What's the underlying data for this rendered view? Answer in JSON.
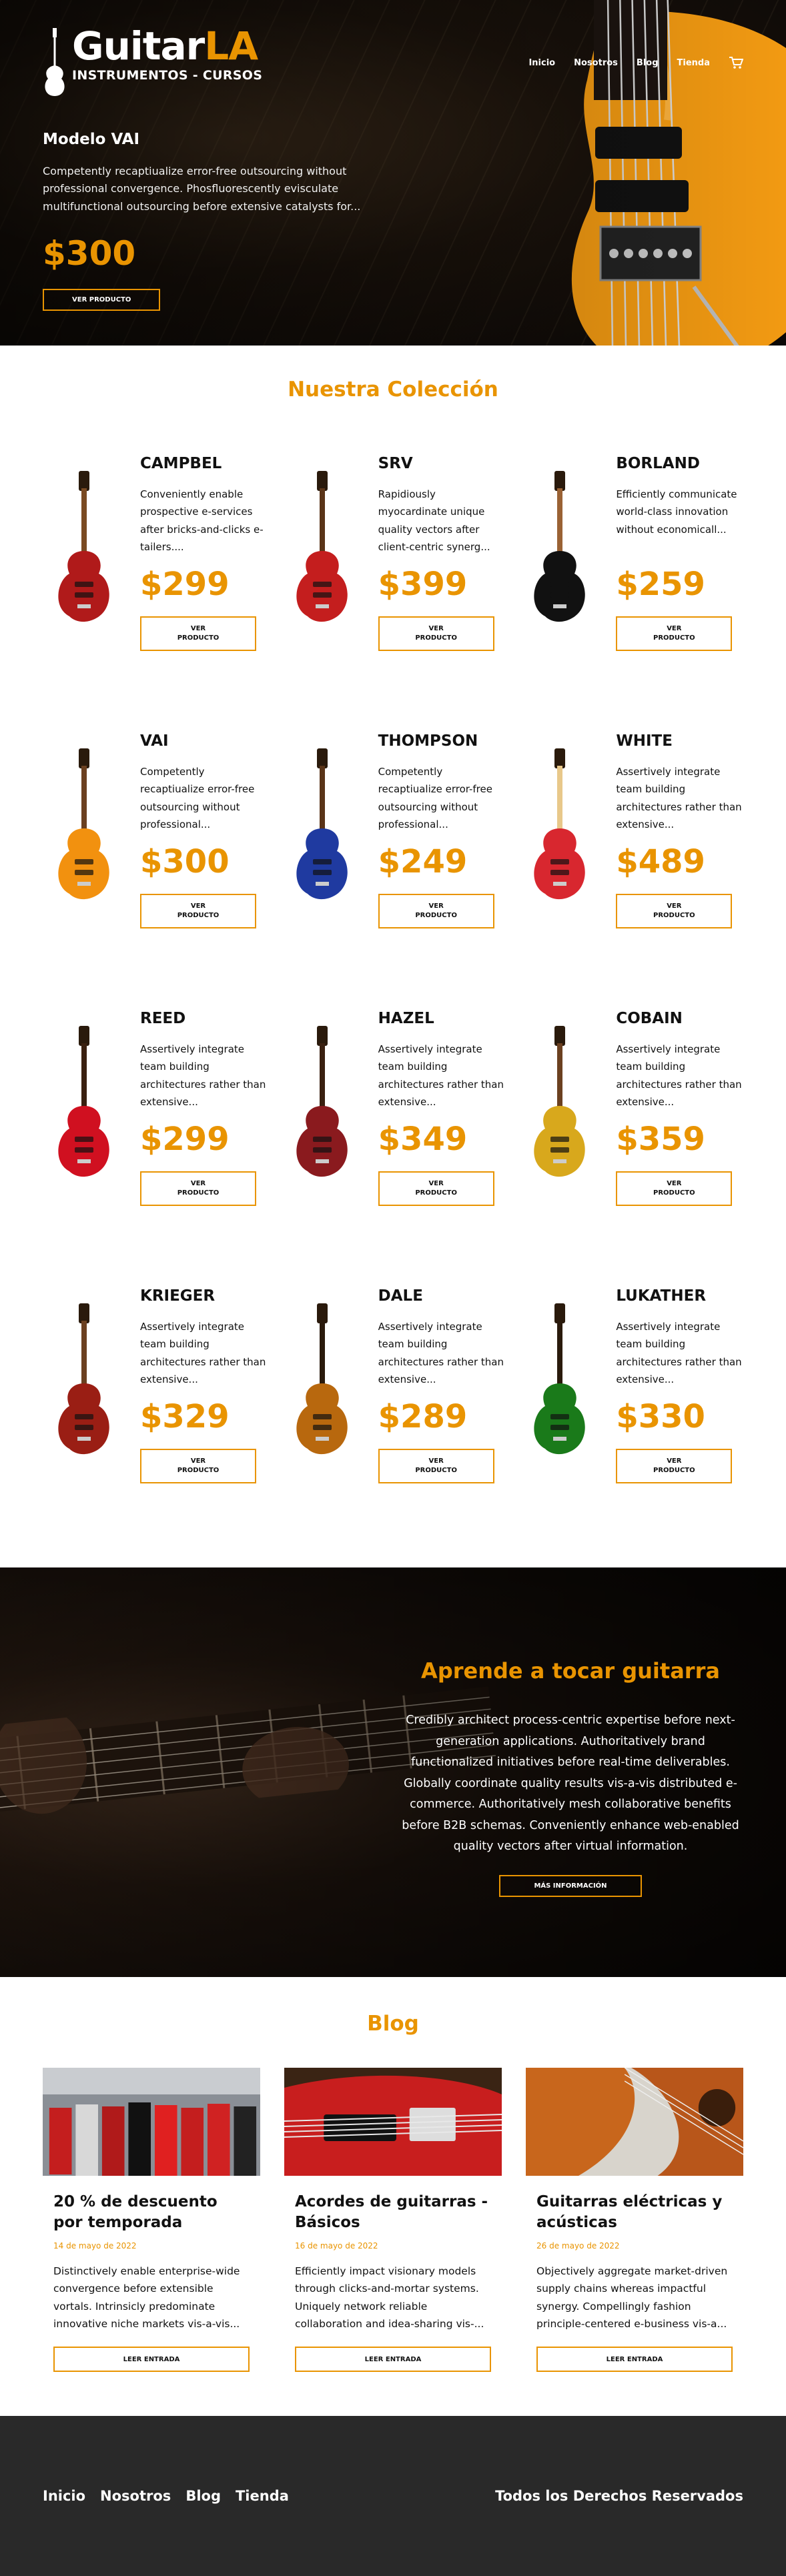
{
  "header": {
    "logo_main": "Guitar",
    "logo_accent": "LA",
    "logo_sub": "INSTRUMENTOS - CURSOS",
    "nav": [
      "Inicio",
      "Nosotros",
      "Blog",
      "Tienda"
    ]
  },
  "hero": {
    "model": "Modelo VAI",
    "description": "Competently recaptiualize error-free outsourcing without professional convergence. Phosfluorescently evisculate multifunctional outsourcing before extensive catalysts for...",
    "price": "$300",
    "button": "VER PRODUCTO"
  },
  "collection": {
    "title": "Nuestra Colección",
    "button_label": "VER PRODUCTO",
    "products": [
      {
        "name": "CAMPBEL",
        "desc": "Conveniently enable prospective e-services after bricks-and-clicks e-tailers....",
        "price": "$299",
        "body": "#b01a1a",
        "neck": "#7a4a22"
      },
      {
        "name": "SRV",
        "desc": "Rapidiously myocardinate unique quality vectors after client-centric synerg...",
        "price": "$399",
        "body": "#c41e1e",
        "neck": "#5a3418"
      },
      {
        "name": "BORLAND",
        "desc": "Efficiently communicate world-class innovation without economicall...",
        "price": "$259",
        "body": "#111111",
        "neck": "#9a6234"
      },
      {
        "name": "VAI",
        "desc": "Competently recaptiualize error-free outsourcing without professional...",
        "price": "$300",
        "body": "#f2910f",
        "neck": "#6b4020"
      },
      {
        "name": "THOMPSON",
        "desc": "Competently recaptiualize error-free outsourcing without professional...",
        "price": "$249",
        "body": "#1f3aa0",
        "neck": "#5a3418"
      },
      {
        "name": "WHITE",
        "desc": "Assertively integrate team building architectures rather than extensive...",
        "price": "$489",
        "body": "#d8272f",
        "neck": "#e8c88a"
      },
      {
        "name": "REED",
        "desc": "Assertively integrate team building architectures rather than extensive...",
        "price": "$299",
        "body": "#d01020",
        "neck": "#3a2010"
      },
      {
        "name": "HAZEL",
        "desc": "Assertively integrate team building architectures rather than extensive...",
        "price": "$349",
        "body": "#8a1a1e",
        "neck": "#3a2010"
      },
      {
        "name": "COBAIN",
        "desc": "Assertively integrate team building architectures rather than extensive...",
        "price": "$359",
        "body": "#d8a81c",
        "neck": "#6b4020"
      },
      {
        "name": "KRIEGER",
        "desc": "Assertively integrate team building architectures rather than extensive...",
        "price": "$329",
        "body": "#9a1e14",
        "neck": "#6b4020"
      },
      {
        "name": "DALE",
        "desc": "Assertively integrate team building architectures rather than extensive...",
        "price": "$289",
        "body": "#b8680e",
        "neck": "#2a1a0c"
      },
      {
        "name": "LUKATHER",
        "desc": "Assertively integrate team building architectures rather than extensive...",
        "price": "$330",
        "body": "#1a7a1a",
        "neck": "#2a1a0c"
      }
    ]
  },
  "course": {
    "title": "Aprende a tocar guitarra",
    "text": "Credibly architect process-centric expertise before next-generation applications. Authoritatively brand functionalized initiatives before real-time deliverables. Globally coordinate quality results vis-a-vis distributed e-commerce. Authoritatively mesh collaborative benefits before B2B schemas. Conveniently enhance web-enabled quality vectors after virtual information.",
    "button": "MÁS INFORMACIÓN"
  },
  "blog": {
    "title": "Blog",
    "button_label": "LEER ENTRADA",
    "posts": [
      {
        "title": "20 % de descuento por temporada",
        "date": "14 de mayo de 2022",
        "desc": "Distinctively enable enterprise-wide convergence before extensible vortals. Intrinsicly predominate innovative niche markets vis-a-vis..."
      },
      {
        "title": "Acordes de guitarras - Básicos",
        "date": "16 de mayo de 2022",
        "desc": "Efficiently impact visionary models through clicks-and-mortar systems. Uniquely network reliable collaboration and idea-sharing vis-..."
      },
      {
        "title": "Guitarras eléctricas y acústicas",
        "date": "26 de mayo de 2022",
        "desc": "Objectively aggregate market-driven supply chains whereas impactful synergy. Compellingly fashion principle-centered e-business vis-a..."
      }
    ]
  },
  "footer": {
    "nav": [
      "Inicio",
      "Nosotros",
      "Blog",
      "Tienda"
    ],
    "copyright": "Todos los Derechos Reservados"
  },
  "colors": {
    "accent": "#e99401",
    "footer_bg": "#292929"
  }
}
